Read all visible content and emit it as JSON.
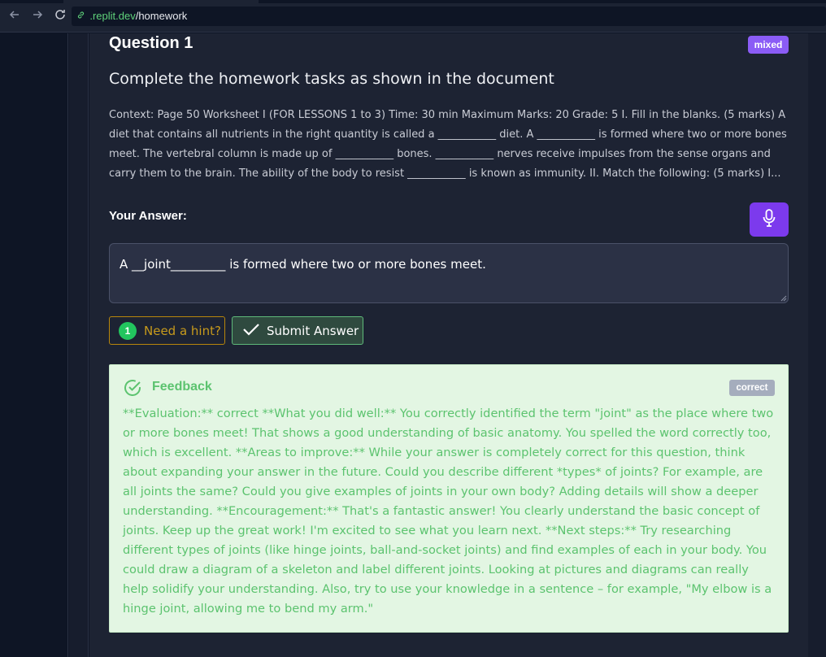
{
  "browser": {
    "url_host": ".replit.dev",
    "url_path": "/homework"
  },
  "question": {
    "title": "Question 1",
    "type_badge": "mixed",
    "subtitle": "Complete the homework tasks as shown in the document",
    "context": "Context: Page 50 Worksheet I (FOR LESSONS 1 to 3) Time: 30 min Maximum Marks: 20 Grade: 5 I. Fill in the blanks. (5 marks) A diet that contains all nutrients in the right quantity is called a ___________ diet. A ___________ is formed where two or more bones meet. The vertebral column is made up of ___________ bones. ___________ nerves receive impulses from the sense organs and carry them to the brain. The ability of the body to resist ___________ is known as immunity. II. Match the following: (5 marks) I..."
  },
  "answer": {
    "label": "Your Answer:",
    "value": "A __joint_________ is formed where two or more bones meet."
  },
  "actions": {
    "hint_count": "1",
    "hint_label": "Need a hint?",
    "submit_label": "Submit Answer"
  },
  "feedback": {
    "title": "Feedback",
    "status_badge": "correct",
    "text": "**Evaluation:** correct **What you did well:** You correctly identified the term \"joint\" as the place where two or more bones meet! That shows a good understanding of basic anatomy. You spelled the word correctly too, which is excellent. **Areas to improve:** While your answer is completely correct for this question, think about expanding your answer in the future. Could you describe different *types* of joints? For example, are all joints the same? Could you give examples of joints in your own body? Adding details will show a deeper understanding. **Encouragement:** That's a fantastic answer! You clearly understand the basic concept of joints. Keep up the great work! I'm excited to see what you learn next. **Next steps:** Try researching different types of joints (like hinge joints, ball-and-socket joints) and find examples of each in your body. You could draw a diagram of a skeleton and label different joints. Looking at pictures and diagrams can really help solidify your understanding. Also, try to use your knowledge in a sentence – for example, \"My elbow is a hinge joint, allowing me to bend my arm.\""
  },
  "icons": {
    "back": "arrow-left-icon",
    "forward": "arrow-right-icon",
    "reload": "reload-icon",
    "link": "link-icon",
    "mic": "microphone-icon",
    "check": "check-icon",
    "feedback": "check-circle-icon"
  },
  "colors": {
    "page_bg": "#0e1525",
    "card_bg": "#1d2333",
    "accent_purple": "#7c3aed",
    "badge_mixed": "#8b5cf6",
    "hint_border": "#b8860b",
    "success_green": "#5cc36f",
    "feedback_bg": "#e3f6e3"
  }
}
